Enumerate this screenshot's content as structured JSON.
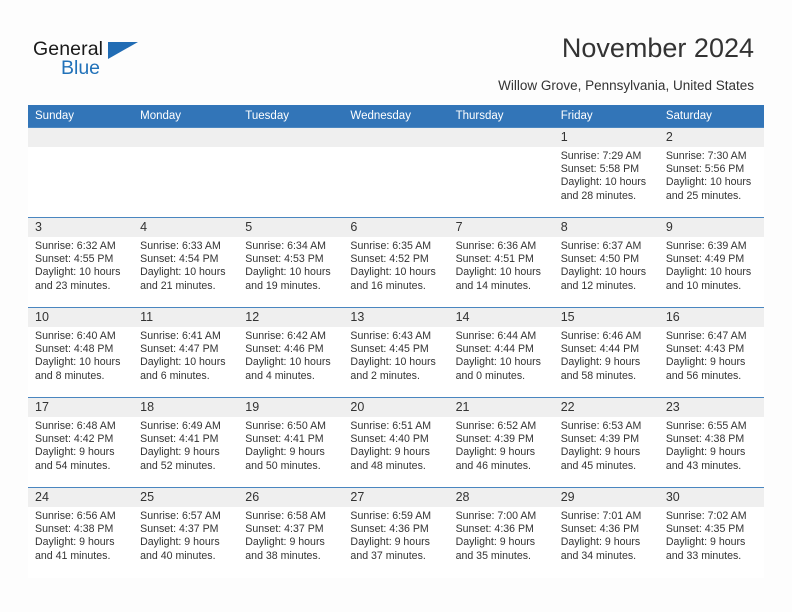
{
  "brand": {
    "name_part1": "General",
    "name_part2": "Blue",
    "triangle_color": "#216cb4",
    "blue_color": "#2272b9"
  },
  "header": {
    "title": "November 2024",
    "subtitle": "Willow Grove, Pennsylvania, United States"
  },
  "theme": {
    "header_row_bg": "#3275b8",
    "header_row_text": "#ffffff",
    "daynum_bg": "#efefef",
    "cell_border": "#4a86c0",
    "page_bg": "#fdfdfd",
    "text": "#333333"
  },
  "calendar": {
    "weekday_headers": [
      "Sunday",
      "Monday",
      "Tuesday",
      "Wednesday",
      "Thursday",
      "Friday",
      "Saturday"
    ],
    "weeks": [
      [
        {
          "day": "",
          "blank": true
        },
        {
          "day": "",
          "blank": true
        },
        {
          "day": "",
          "blank": true
        },
        {
          "day": "",
          "blank": true
        },
        {
          "day": "",
          "blank": true
        },
        {
          "day": "1",
          "sunrise": "Sunrise: 7:29 AM",
          "sunset": "Sunset: 5:58 PM",
          "daylight": "Daylight: 10 hours and 28 minutes."
        },
        {
          "day": "2",
          "sunrise": "Sunrise: 7:30 AM",
          "sunset": "Sunset: 5:56 PM",
          "daylight": "Daylight: 10 hours and 25 minutes."
        }
      ],
      [
        {
          "day": "3",
          "sunrise": "Sunrise: 6:32 AM",
          "sunset": "Sunset: 4:55 PM",
          "daylight": "Daylight: 10 hours and 23 minutes."
        },
        {
          "day": "4",
          "sunrise": "Sunrise: 6:33 AM",
          "sunset": "Sunset: 4:54 PM",
          "daylight": "Daylight: 10 hours and 21 minutes."
        },
        {
          "day": "5",
          "sunrise": "Sunrise: 6:34 AM",
          "sunset": "Sunset: 4:53 PM",
          "daylight": "Daylight: 10 hours and 19 minutes."
        },
        {
          "day": "6",
          "sunrise": "Sunrise: 6:35 AM",
          "sunset": "Sunset: 4:52 PM",
          "daylight": "Daylight: 10 hours and 16 minutes."
        },
        {
          "day": "7",
          "sunrise": "Sunrise: 6:36 AM",
          "sunset": "Sunset: 4:51 PM",
          "daylight": "Daylight: 10 hours and 14 minutes."
        },
        {
          "day": "8",
          "sunrise": "Sunrise: 6:37 AM",
          "sunset": "Sunset: 4:50 PM",
          "daylight": "Daylight: 10 hours and 12 minutes."
        },
        {
          "day": "9",
          "sunrise": "Sunrise: 6:39 AM",
          "sunset": "Sunset: 4:49 PM",
          "daylight": "Daylight: 10 hours and 10 minutes."
        }
      ],
      [
        {
          "day": "10",
          "sunrise": "Sunrise: 6:40 AM",
          "sunset": "Sunset: 4:48 PM",
          "daylight": "Daylight: 10 hours and 8 minutes."
        },
        {
          "day": "11",
          "sunrise": "Sunrise: 6:41 AM",
          "sunset": "Sunset: 4:47 PM",
          "daylight": "Daylight: 10 hours and 6 minutes."
        },
        {
          "day": "12",
          "sunrise": "Sunrise: 6:42 AM",
          "sunset": "Sunset: 4:46 PM",
          "daylight": "Daylight: 10 hours and 4 minutes."
        },
        {
          "day": "13",
          "sunrise": "Sunrise: 6:43 AM",
          "sunset": "Sunset: 4:45 PM",
          "daylight": "Daylight: 10 hours and 2 minutes."
        },
        {
          "day": "14",
          "sunrise": "Sunrise: 6:44 AM",
          "sunset": "Sunset: 4:44 PM",
          "daylight": "Daylight: 10 hours and 0 minutes."
        },
        {
          "day": "15",
          "sunrise": "Sunrise: 6:46 AM",
          "sunset": "Sunset: 4:44 PM",
          "daylight": "Daylight: 9 hours and 58 minutes."
        },
        {
          "day": "16",
          "sunrise": "Sunrise: 6:47 AM",
          "sunset": "Sunset: 4:43 PM",
          "daylight": "Daylight: 9 hours and 56 minutes."
        }
      ],
      [
        {
          "day": "17",
          "sunrise": "Sunrise: 6:48 AM",
          "sunset": "Sunset: 4:42 PM",
          "daylight": "Daylight: 9 hours and 54 minutes."
        },
        {
          "day": "18",
          "sunrise": "Sunrise: 6:49 AM",
          "sunset": "Sunset: 4:41 PM",
          "daylight": "Daylight: 9 hours and 52 minutes."
        },
        {
          "day": "19",
          "sunrise": "Sunrise: 6:50 AM",
          "sunset": "Sunset: 4:41 PM",
          "daylight": "Daylight: 9 hours and 50 minutes."
        },
        {
          "day": "20",
          "sunrise": "Sunrise: 6:51 AM",
          "sunset": "Sunset: 4:40 PM",
          "daylight": "Daylight: 9 hours and 48 minutes."
        },
        {
          "day": "21",
          "sunrise": "Sunrise: 6:52 AM",
          "sunset": "Sunset: 4:39 PM",
          "daylight": "Daylight: 9 hours and 46 minutes."
        },
        {
          "day": "22",
          "sunrise": "Sunrise: 6:53 AM",
          "sunset": "Sunset: 4:39 PM",
          "daylight": "Daylight: 9 hours and 45 minutes."
        },
        {
          "day": "23",
          "sunrise": "Sunrise: 6:55 AM",
          "sunset": "Sunset: 4:38 PM",
          "daylight": "Daylight: 9 hours and 43 minutes."
        }
      ],
      [
        {
          "day": "24",
          "sunrise": "Sunrise: 6:56 AM",
          "sunset": "Sunset: 4:38 PM",
          "daylight": "Daylight: 9 hours and 41 minutes."
        },
        {
          "day": "25",
          "sunrise": "Sunrise: 6:57 AM",
          "sunset": "Sunset: 4:37 PM",
          "daylight": "Daylight: 9 hours and 40 minutes."
        },
        {
          "day": "26",
          "sunrise": "Sunrise: 6:58 AM",
          "sunset": "Sunset: 4:37 PM",
          "daylight": "Daylight: 9 hours and 38 minutes."
        },
        {
          "day": "27",
          "sunrise": "Sunrise: 6:59 AM",
          "sunset": "Sunset: 4:36 PM",
          "daylight": "Daylight: 9 hours and 37 minutes."
        },
        {
          "day": "28",
          "sunrise": "Sunrise: 7:00 AM",
          "sunset": "Sunset: 4:36 PM",
          "daylight": "Daylight: 9 hours and 35 minutes."
        },
        {
          "day": "29",
          "sunrise": "Sunrise: 7:01 AM",
          "sunset": "Sunset: 4:36 PM",
          "daylight": "Daylight: 9 hours and 34 minutes."
        },
        {
          "day": "30",
          "sunrise": "Sunrise: 7:02 AM",
          "sunset": "Sunset: 4:35 PM",
          "daylight": "Daylight: 9 hours and 33 minutes."
        }
      ]
    ]
  }
}
